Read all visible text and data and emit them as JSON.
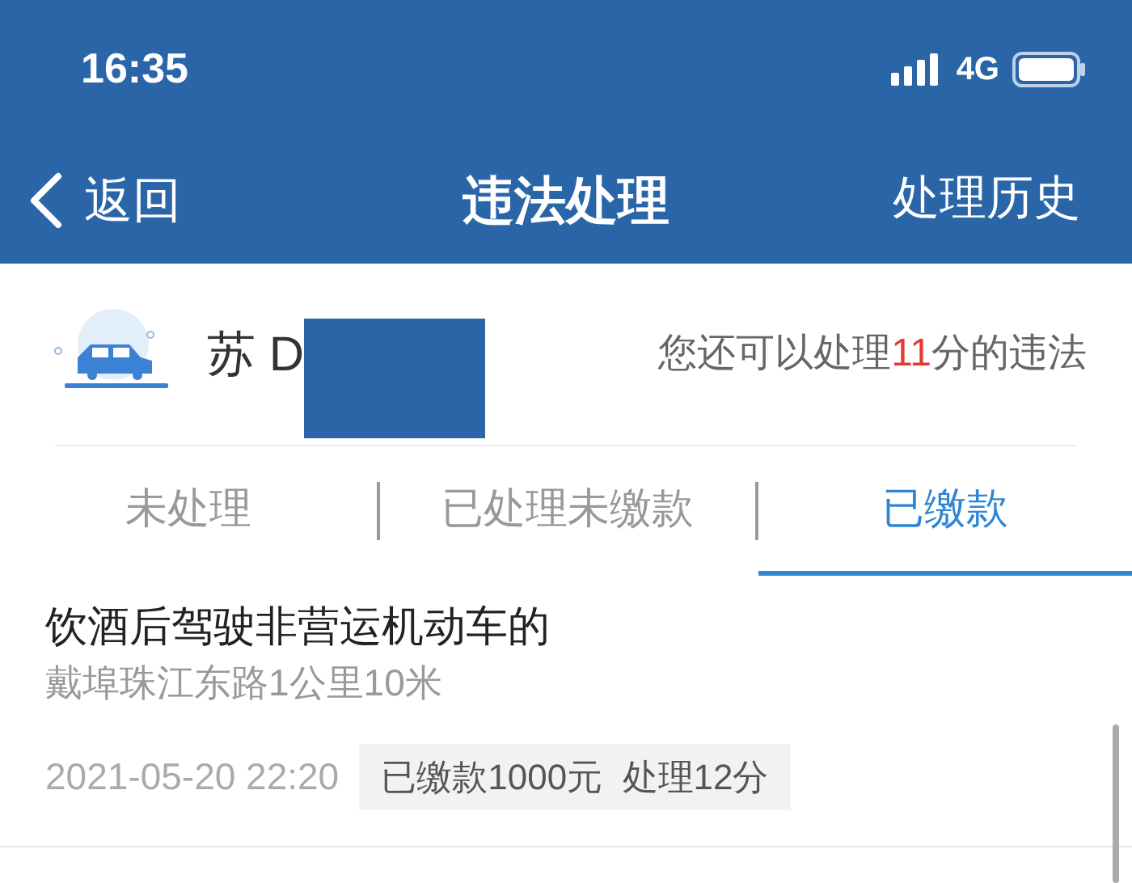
{
  "status_bar": {
    "time": "16:35",
    "network": "4G"
  },
  "nav": {
    "back": "返回",
    "title": "违法处理",
    "action": "处理历史"
  },
  "vehicle": {
    "plate": "苏 D",
    "points_prefix": "您还可以处理",
    "points": "11",
    "points_suffix": "分的违法"
  },
  "tabs": [
    {
      "label": "未处理",
      "selected": false
    },
    {
      "label": "已处理未缴款",
      "selected": false
    },
    {
      "label": "已缴款",
      "selected": true
    }
  ],
  "records": [
    {
      "title": "饮酒后驾驶非营运机动车的",
      "location": "戴埠珠江东路1公里10米",
      "time": "2021-05-20 22:20",
      "status": "已缴款1000元  处理12分"
    }
  ]
}
